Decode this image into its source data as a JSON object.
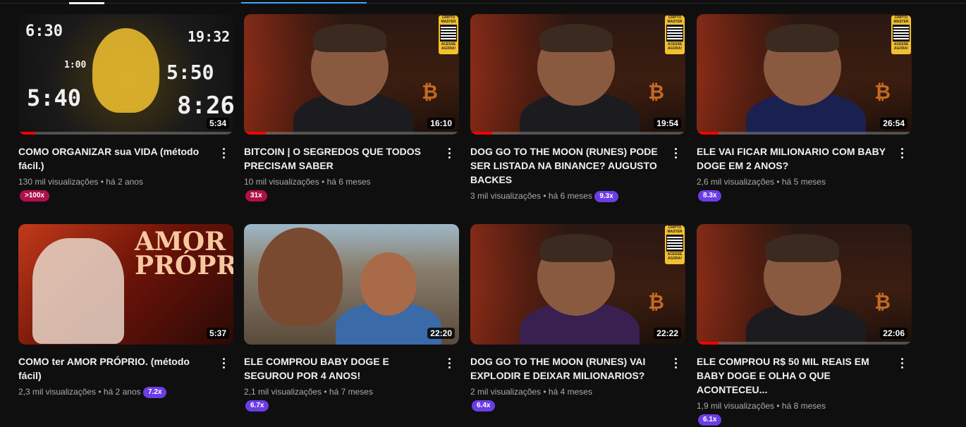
{
  "videos": [
    {
      "title": "COMO ORGANIZAR sua VIDA (método fácil.)",
      "views": "130 mil visualizações",
      "age": "há 2 anos",
      "duration": "5:34",
      "multiplier": ">100x",
      "progress_pct": 8,
      "thumb": "clock"
    },
    {
      "title": "BITCOIN | O SEGREDOS QUE TODOS PRECISAM SABER",
      "views": "10 mil visualizações",
      "age": "há 6 meses",
      "duration": "16:10",
      "multiplier": "31x",
      "progress_pct": 10,
      "thumb": "studio"
    },
    {
      "title": "DOG GO TO THE MOON (RUNES) PODE SER LISTADA NA BINANCE? AUGUSTO BACKES",
      "views": "3 mil visualizações",
      "age": "há 6 meses",
      "duration": "19:54",
      "multiplier": "9.3x",
      "progress_pct": 10,
      "thumb": "studio"
    },
    {
      "title": "ELE VAI FICAR MILIONARIO COM BABY DOGE EM 2 ANOS?",
      "views": "2,6 mil visualizações",
      "age": "há 5 meses",
      "duration": "26:54",
      "multiplier": "8.3x",
      "progress_pct": 10,
      "thumb": "studio"
    },
    {
      "title": "COMO ter AMOR PRÓPRIO. (método fácil)",
      "views": "2,3 mil visualizações",
      "age": "há 2 anos",
      "duration": "5:37",
      "multiplier": "7.2x",
      "progress_pct": 0,
      "thumb": "amor"
    },
    {
      "title": "ELE COMPROU BABY DOGE E SEGUROU POR 4 ANOS!",
      "views": "2,1 mil visualizações",
      "age": "há 7 meses",
      "duration": "22:20",
      "multiplier": "6.7x",
      "progress_pct": 0,
      "thumb": "outdoor"
    },
    {
      "title": "DOG GO TO THE MOON (RUNES) VAI EXPLODIR E DEIXAR MILIONARIOS?",
      "views": "2 mil visualizações",
      "age": "há 4 meses",
      "duration": "22:22",
      "multiplier": "6.4x",
      "progress_pct": 0,
      "thumb": "studio"
    },
    {
      "title": "ELE COMPROU R$ 50 MIL REAIS EM BABY DOGE E OLHA O QUE ACONTECEU...",
      "views": "1,9 mil visualizações",
      "age": "há 8 meses",
      "duration": "22:06",
      "multiplier": "6.1x",
      "progress_pct": 10,
      "thumb": "studio"
    }
  ],
  "clock_times": [
    "6:30",
    "19:32",
    "1:00",
    "5:50",
    "5:40",
    "8:26"
  ],
  "studio_coin": "₿",
  "qr_label_top": "CRIPTO MASTER",
  "qr_label_bottom": "ACESSE AGORA!",
  "amor_word": "AMOR PRÓPRIO",
  "colors": {
    "background": "#0f0f0f",
    "red_pill": "#b0104a",
    "purple_pill": "#6b3de6",
    "progress": "#ff0000"
  }
}
